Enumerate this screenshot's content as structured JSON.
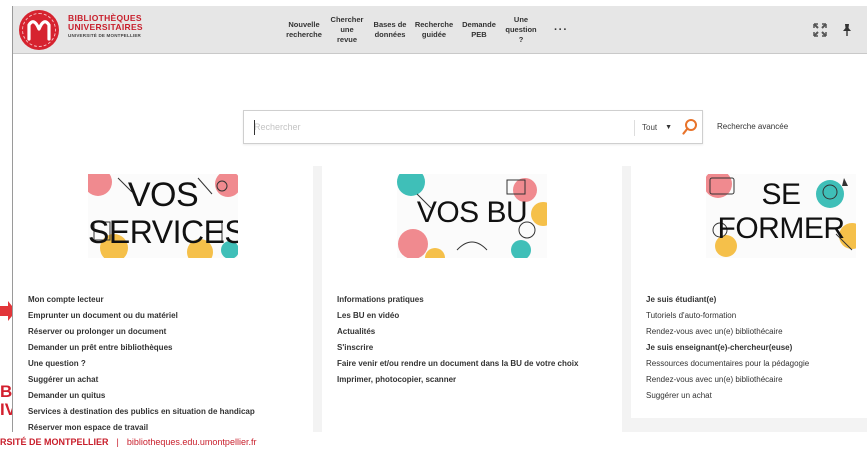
{
  "header": {
    "logo_line1": "BIBLIOTHÈQUES",
    "logo_line2": "UNIVERSITAIRES",
    "logo_line3": "UNIVERSITÉ DE MONTPELLIER",
    "nav": [
      {
        "label": "Nouvelle\nrecherche"
      },
      {
        "label": "Chercher\nune\nrevue"
      },
      {
        "label": "Bases de\ndonnées"
      },
      {
        "label": "Recherche\nguidée"
      },
      {
        "label": "Demande\nPEB"
      },
      {
        "label": "Une\nquestion\n?"
      }
    ],
    "more_label": "···"
  },
  "search": {
    "placeholder": "Rechercher",
    "scope": "Tout",
    "advanced_label": "Recherche avancée"
  },
  "cards": {
    "services": {
      "title_line1": "VOS",
      "title_line2": "SERVICES",
      "links": [
        "Mon compte lecteur",
        "Emprunter un document ou du matériel",
        "Réserver ou prolonger un document",
        "Demander un prêt entre bibliothèques",
        "Une question ?",
        "Suggérer un achat",
        "Demander un quitus",
        "Services à destination des publics en situation de handicap",
        "Réserver mon espace de travail"
      ]
    },
    "bu": {
      "title": "VOS BU",
      "links": [
        "Informations pratiques",
        "Les BU en vidéo",
        "Actualités",
        "S'inscrire",
        "Faire venir et/ou rendre un document dans la BU de votre choix",
        "Imprimer, photocopier, scanner"
      ]
    },
    "former": {
      "title_line1": "SE",
      "title_line2": "FORMER",
      "links": [
        "Je suis étudiant(e)",
        "Tutoriels d'auto-formation",
        "Rendez-vous avec un(e) bibliothécaire",
        "Je suis enseignant(e)-chercheur(euse)",
        "Ressources documentaires pour la pédagogie",
        "Rendez-vous avec un(e) bibliothécaire",
        "Suggérer un achat"
      ]
    }
  },
  "outside": {
    "brand_left_line1": "BL",
    "brand_left_line2": "IV",
    "footer_univ": "RSITÉ DE MONTPELLIER",
    "footer_sep": "|",
    "footer_url": "bibliotheques.edu.umontpellier.fr"
  },
  "colors": {
    "brand_red": "#d6232f",
    "accent_orange": "#e8732a",
    "illustration_pink": "#f08a8f",
    "illustration_teal": "#3fbfb8",
    "illustration_yellow": "#f5c04a"
  },
  "icons": [
    "university-logo-icon",
    "expand-icon",
    "pin-icon",
    "search-icon",
    "dropdown-arrow-icon",
    "red-arrow-icon"
  ]
}
